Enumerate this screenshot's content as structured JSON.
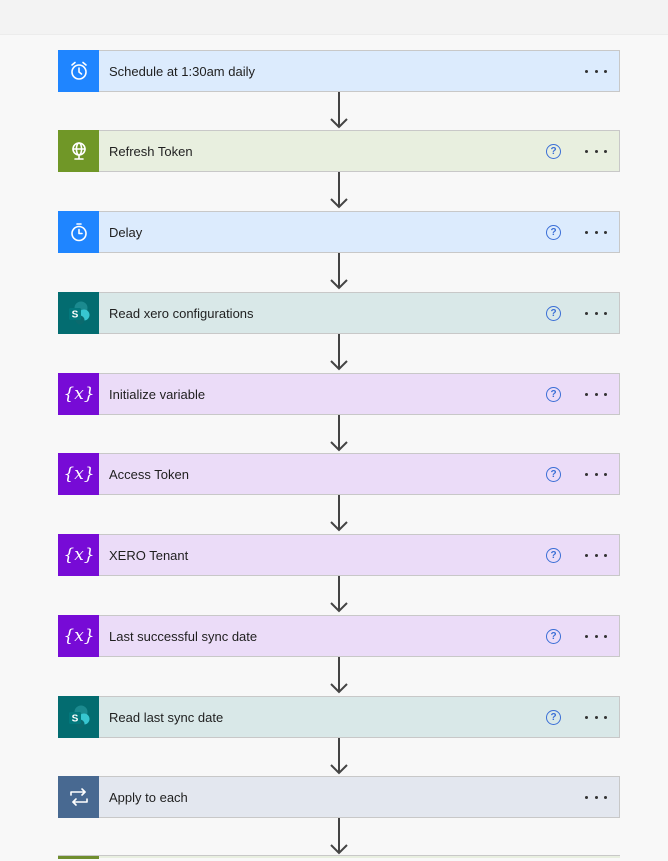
{
  "steps": [
    {
      "title": "Schedule at 1:30am daily",
      "icon": "alarm-clock-icon",
      "iconColor": "#1f85ff",
      "bg": "#dcebfd",
      "help": false
    },
    {
      "title": "Refresh Token",
      "icon": "globe-icon",
      "iconColor": "#709727",
      "bg": "#e8efdf",
      "help": true
    },
    {
      "title": "Delay",
      "icon": "timer-icon",
      "iconColor": "#1f85ff",
      "bg": "#dcebfd",
      "help": true
    },
    {
      "title": "Read xero configurations",
      "icon": "sharepoint-icon",
      "iconColor": "#036c70",
      "bg": "#d9e8e8",
      "help": true
    },
    {
      "title": "Initialize variable",
      "icon": "variable-icon",
      "iconColor": "#770bd6",
      "bg": "#ebdcf8",
      "help": true
    },
    {
      "title": "Access Token",
      "icon": "variable-icon",
      "iconColor": "#770bd6",
      "bg": "#ebdcf8",
      "help": true
    },
    {
      "title": "XERO Tenant",
      "icon": "variable-icon",
      "iconColor": "#770bd6",
      "bg": "#ebdcf8",
      "help": true
    },
    {
      "title": "Last successful sync date",
      "icon": "variable-icon",
      "iconColor": "#770bd6",
      "bg": "#ebdcf8",
      "help": true
    },
    {
      "title": "Read last sync date",
      "icon": "sharepoint-icon",
      "iconColor": "#036c70",
      "bg": "#d9e8e8",
      "help": true
    },
    {
      "title": "Apply to each",
      "icon": "loop-icon",
      "iconColor": "#486991",
      "bg": "#e3e7ef",
      "help": false
    }
  ],
  "helpGlyph": "?",
  "variableGlyph": "{x}"
}
